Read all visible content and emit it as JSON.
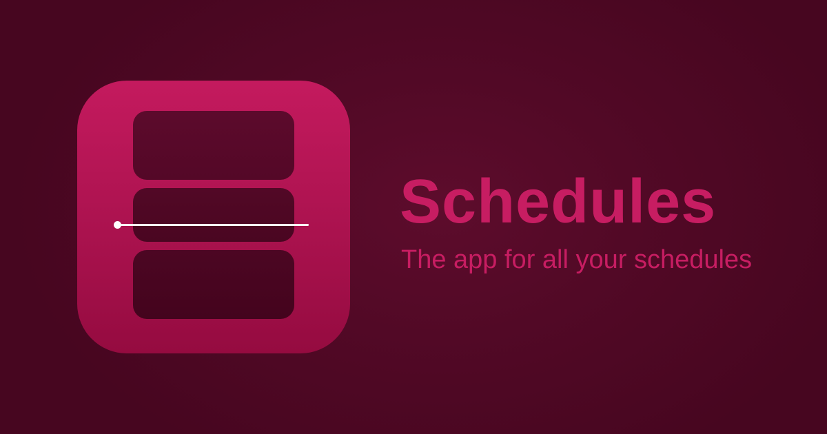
{
  "app": {
    "icon_name": "schedules-app-icon",
    "title": "Schedules",
    "tagline": "The app for all your schedules"
  },
  "colors": {
    "background": "#520926",
    "brand_accent": "#c71d62",
    "icon_top": "#c41a5e",
    "icon_bottom": "#950b40",
    "slot": "#4f0724",
    "indicator": "#ffffff"
  }
}
